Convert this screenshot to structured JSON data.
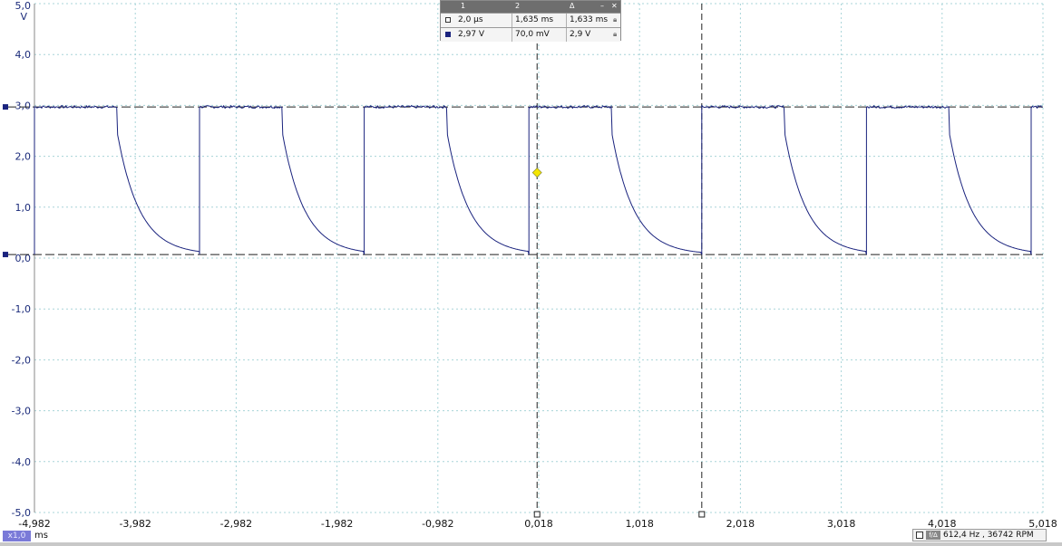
{
  "chart_data": {
    "type": "line",
    "x_unit": "ms",
    "y_unit": "V",
    "xlim": [
      -4.982,
      5.018
    ],
    "ylim": [
      -5.0,
      5.0
    ],
    "x_ticks": [
      "-4,982",
      "-3,982",
      "-2,982",
      "-1,982",
      "-0,982",
      "0,018",
      "1,018",
      "2,018",
      "3,018",
      "4,018",
      "5,018"
    ],
    "x_tick_values": [
      -4.982,
      -3.982,
      -2.982,
      -1.982,
      -0.982,
      0.018,
      1.018,
      2.018,
      3.018,
      4.018,
      5.018
    ],
    "y_ticks": [
      "5,0",
      "4,0",
      "3,0",
      "2,0",
      "1,0",
      "0,0",
      "-1,0",
      "-2,0",
      "-3,0",
      "-4,0",
      "-5,0"
    ],
    "y_tick_values": [
      5,
      4,
      3,
      2,
      1,
      0,
      -1,
      -2,
      -3,
      -4,
      -5
    ],
    "grid": true,
    "signal": {
      "color": "#1a237e",
      "high_v": 2.97,
      "low_v": 0.07,
      "period_ms": 1.633,
      "rise_times_ms": [
        -4.982,
        -3.345,
        -1.712,
        -0.079,
        1.635,
        3.268,
        4.901
      ],
      "high_duration_ms": 0.825,
      "fall_drop_v": 0.55,
      "decay_tau_ms": 0.22
    },
    "cursors": {
      "time1_ms": 0.002,
      "time2_ms": 1.635,
      "level1_v": 2.97,
      "level2_v": 0.07,
      "trigger_v": 1.68,
      "trigger_color": "#f4e600"
    }
  },
  "measurements": {
    "header": [
      "1",
      "2",
      "Δ"
    ],
    "rows": [
      {
        "c1": "2,0 µs",
        "c2": "1,635 ms",
        "c3": "1,633 ms",
        "swatch": "#ffffff"
      },
      {
        "c1": "2,97 V",
        "c2": "70,0 mV",
        "c3": "2,9 V",
        "swatch": "#1a237e"
      }
    ],
    "minimize": "–",
    "close": "✕"
  },
  "ui": {
    "zoom": "x1,0",
    "x_unit_label": "ms",
    "y_unit_label": "V",
    "frequency_badge": "f/Δ",
    "frequency_text": "612,4 Hz , 36742 RPM"
  }
}
